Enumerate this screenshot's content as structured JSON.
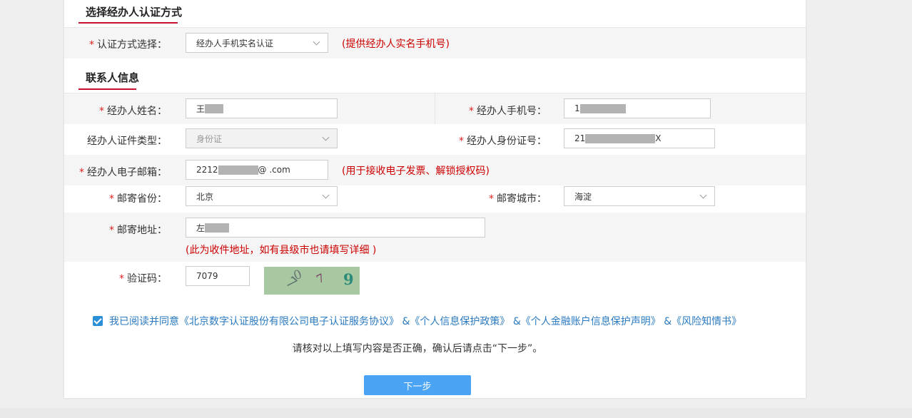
{
  "section_auth": {
    "title": "选择经办人认证方式"
  },
  "auth_method": {
    "label": "认证方式选择：",
    "value": "经办人手机实名认证",
    "hint": "(提供经办人实名手机号)"
  },
  "section_contact": {
    "title": "联系人信息"
  },
  "fields": {
    "name": {
      "label": "经办人姓名：",
      "prefix": "王",
      "suffix": "",
      "masked": true
    },
    "phone": {
      "label": "经办人手机号：",
      "prefix": "1",
      "suffix": "",
      "masked": true
    },
    "id_type": {
      "label": "经办人证件类型：",
      "value": "身份证"
    },
    "id_number": {
      "label": "经办人身份证号：",
      "prefix": "21",
      "suffix": "X",
      "masked": true
    },
    "email": {
      "label": "经办人电子邮箱：",
      "prefix": "2212",
      "suffix": "@   .com",
      "masked": true,
      "hint": "(用于接收电子发票、解锁授权码)"
    },
    "province": {
      "label": "邮寄省份：",
      "value": "北京"
    },
    "city": {
      "label": "邮寄城市：",
      "value": "海淀"
    },
    "address": {
      "label": "邮寄地址：",
      "prefix": "左",
      "suffix": "",
      "masked": true,
      "hint": "(此为收件地址，如有县级市也请填写详细 )"
    },
    "captcha": {
      "label": "验证码：",
      "value": "7079",
      "image_chars": [
        "7",
        "0",
        "7",
        "9"
      ]
    }
  },
  "agreement": {
    "checked": true,
    "prefix": "我已阅读并同意",
    "links": [
      "《北京数字认证股份有限公司电子认证服务协议》",
      "《个人信息保护政策》",
      "《个人金融账户信息保护声明》",
      "《风险知情书》"
    ],
    "separator": "&"
  },
  "confirm_text": "请核对以上填写内容是否正确，确认后请点击“下一步”。",
  "next_button": {
    "label": "下一步"
  },
  "colors": {
    "accent_red": "#c8102e",
    "hint_red": "#cc0000",
    "link_blue": "#2a7ac0",
    "button_blue": "#4aa3f3"
  }
}
